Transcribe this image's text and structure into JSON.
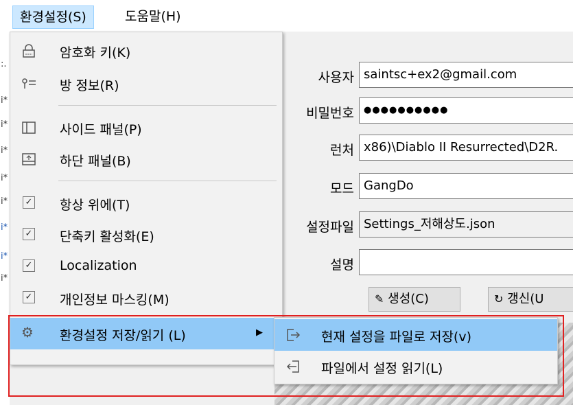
{
  "menubar": {
    "settings": "환경설정(S)",
    "help": "도움말(H)"
  },
  "left_strip": [
    "i*",
    "i*",
    "i*",
    "i*",
    "i*",
    "i*",
    "i*",
    "i*"
  ],
  "form": {
    "user_label": "사용자",
    "user_value": "saintsc+ex2@gmail.com",
    "password_label": "비밀번호",
    "password_value": "●●●●●●●●●●",
    "launcher_label": "런처",
    "launcher_value": "x86)\\Diablo II Resurrected\\D2R.",
    "mode_label": "모드",
    "mode_value": "GangDo",
    "settings_file_label": "설정파일",
    "settings_file_value": "Settings_저해상도.json",
    "description_label": "설명",
    "description_value": "",
    "create_button": "생성(C)",
    "update_button": "갱신(U"
  },
  "menu": {
    "encryption_key": "암호화 키(K)",
    "room_info": "방 정보(R)",
    "side_panel": "사이드 패널(P)",
    "bottom_panel": "하단 패널(B)",
    "always_on_top": "항상 위에(T)",
    "hotkey_enable": "단축키 활성화(E)",
    "localization": "Localization",
    "privacy_masking": "개인정보 마스킹(M)",
    "save_load": "환경설정 저장/읽기 (L)"
  },
  "submenu": {
    "save_current": "현재 설정을 파일로 저장(v)",
    "load_file": "파일에서 설정 읽기(L)"
  },
  "colors": {
    "highlight": "#91c9f7",
    "redbox": "#e02020",
    "menubar_active": "#cce8ff"
  }
}
